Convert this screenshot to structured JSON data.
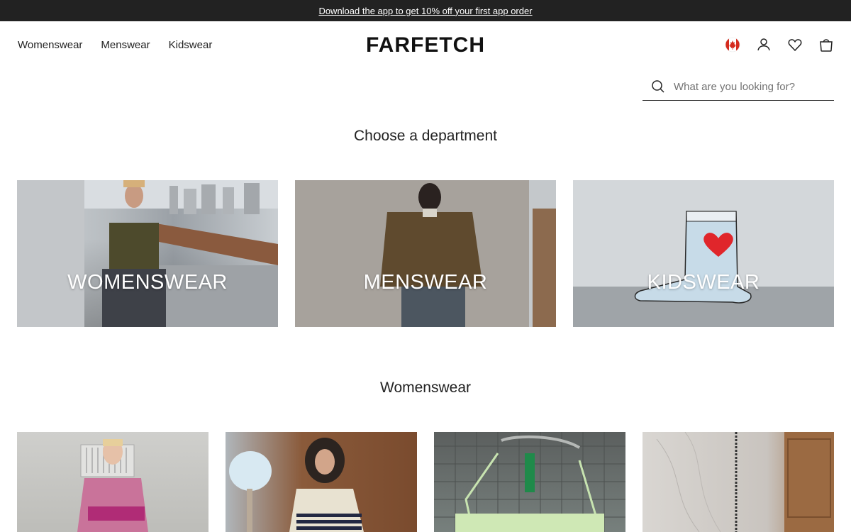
{
  "promo": {
    "text": "Download the app to get 10% off your first app order"
  },
  "header": {
    "nav": [
      "Womenswear",
      "Menswear",
      "Kidswear"
    ],
    "logo": "FARFETCH",
    "icons": [
      "canada-flag-icon",
      "account-icon",
      "wishlist-heart-icon",
      "shopping-bag-icon"
    ]
  },
  "search": {
    "placeholder": "What are you looking for?"
  },
  "departments": {
    "title": "Choose a department",
    "items": [
      {
        "label": "WOMENSWEAR"
      },
      {
        "label": "MENSWEAR"
      },
      {
        "label": "KIDSWEAR"
      }
    ]
  },
  "womenswear": {
    "title": "Womenswear"
  },
  "colors": {
    "promo_bg": "#222222",
    "text": "#222222",
    "placeholder": "#727272",
    "flag_red": "#d52b1e"
  }
}
